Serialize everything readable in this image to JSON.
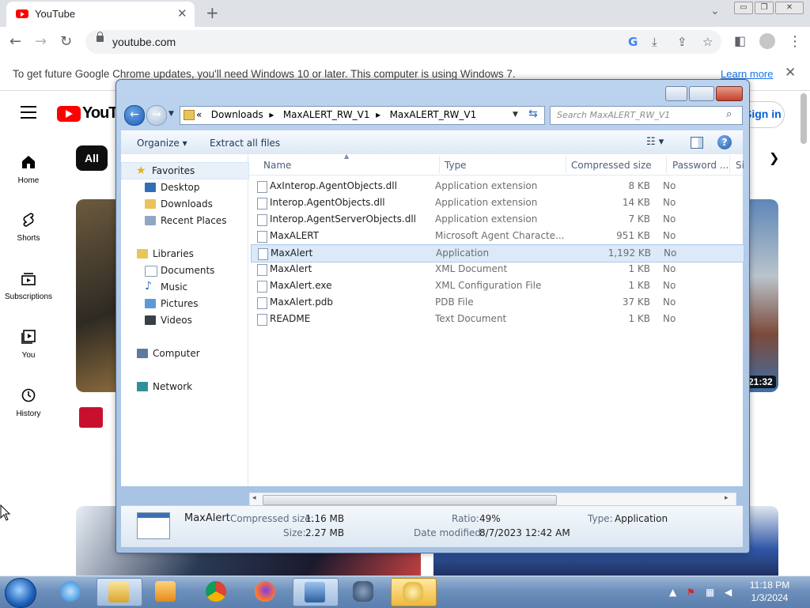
{
  "browser": {
    "tab_title": "YouTube",
    "tab_close": "✕",
    "new_tab": "+",
    "url": "youtube.com",
    "window_controls": [
      "▭",
      "❐",
      "✕"
    ]
  },
  "infobar": {
    "message": "To get future Google Chrome updates, you'll need Windows 10 or later. This computer is using Windows 7.",
    "link": "Learn more",
    "close": "✕"
  },
  "youtube": {
    "logo_text": "YouTube",
    "sign_in": "Sign in",
    "chip_all": "All",
    "sidebar": [
      {
        "label": "Home",
        "icon": "home-icon"
      },
      {
        "label": "Shorts",
        "icon": "shorts-icon"
      },
      {
        "label": "Subscriptions",
        "icon": "subscriptions-icon"
      },
      {
        "label": "You",
        "icon": "you-icon"
      },
      {
        "label": "History",
        "icon": "history-icon"
      }
    ],
    "duration": "21:32"
  },
  "explorer": {
    "breadcrumb": [
      "«",
      "Downloads",
      "MaxALERT_RW_V1",
      "MaxALERT_RW_V1"
    ],
    "search_placeholder": "Search MaxALERT_RW_V1",
    "commands": {
      "organize": "Organize",
      "extract": "Extract all files"
    },
    "nav": {
      "favorites": "Favorites",
      "desktop": "Desktop",
      "downloads": "Downloads",
      "recent": "Recent Places",
      "libraries": "Libraries",
      "documents": "Documents",
      "music": "Music",
      "pictures": "Pictures",
      "videos": "Videos",
      "computer": "Computer",
      "network": "Network"
    },
    "columns": [
      "Name",
      "Type",
      "Compressed size",
      "Password ...",
      "Si"
    ],
    "files": [
      {
        "name": "AxInterop.AgentObjects.dll",
        "type": "Application extension",
        "size": "8 KB",
        "password": "No"
      },
      {
        "name": "Interop.AgentObjects.dll",
        "type": "Application extension",
        "size": "14 KB",
        "password": "No"
      },
      {
        "name": "Interop.AgentServerObjects.dll",
        "type": "Application extension",
        "size": "7 KB",
        "password": "No"
      },
      {
        "name": "MaxALERT",
        "type": "Microsoft Agent Characte...",
        "size": "951 KB",
        "password": "No"
      },
      {
        "name": "MaxAlert",
        "type": "Application",
        "size": "1,192 KB",
        "password": "No"
      },
      {
        "name": "MaxAlert",
        "type": "XML Document",
        "size": "1 KB",
        "password": "No"
      },
      {
        "name": "MaxAlert.exe",
        "type": "XML Configuration File",
        "size": "1 KB",
        "password": "No"
      },
      {
        "name": "MaxAlert.pdb",
        "type": "PDB File",
        "size": "37 KB",
        "password": "No"
      },
      {
        "name": "README",
        "type": "Text Document",
        "size": "1 KB",
        "password": "No"
      }
    ],
    "details": {
      "name": "MaxAlert",
      "compressed_label": "Compressed size:",
      "compressed_value": "1.16 MB",
      "size_label": "Size:",
      "size_value": "2.27 MB",
      "ratio_label": "Ratio:",
      "ratio_value": "49%",
      "modified_label": "Date modified:",
      "modified_value": "8/7/2023 12:42 AM",
      "type_label": "Type:",
      "type_value": "Application"
    }
  },
  "taskbar": {
    "time": "11:18 PM",
    "date": "1/3/2024"
  }
}
